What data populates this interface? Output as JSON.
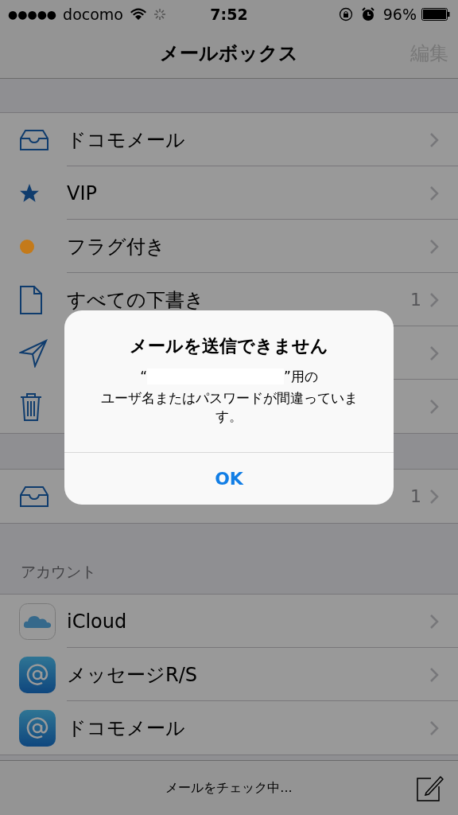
{
  "status_bar": {
    "carrier": "docomo",
    "signal_dots": "●●●●●",
    "time": "7:52",
    "battery": "96%"
  },
  "nav": {
    "title": "メールボックス",
    "edit": "編集"
  },
  "mailboxes": [
    {
      "kind": "inbox",
      "label": "ドコモメール"
    },
    {
      "kind": "star",
      "label": "VIP"
    },
    {
      "kind": "dot",
      "label": "フラグ付き",
      "color": "#c47a1a"
    },
    {
      "kind": "draft",
      "label": "すべての下書き",
      "count": "1"
    },
    {
      "kind": "sent"
    },
    {
      "kind": "trash"
    }
  ],
  "second_section": [
    {
      "kind": "inbox",
      "count": "1"
    }
  ],
  "accounts_header": "アカウント",
  "accounts": [
    {
      "kind": "icloud",
      "label": "iCloud"
    },
    {
      "kind": "at",
      "label": "メッセージR/S"
    },
    {
      "kind": "at",
      "label": "ドコモメール"
    }
  ],
  "toolbar": {
    "status": "メールをチェック中..."
  },
  "alert": {
    "title": "メールを送信できません",
    "quote_open": "“",
    "quote_close": "”用の",
    "message": "ユーザ名またはパスワードが間違っています。",
    "button": "OK"
  }
}
